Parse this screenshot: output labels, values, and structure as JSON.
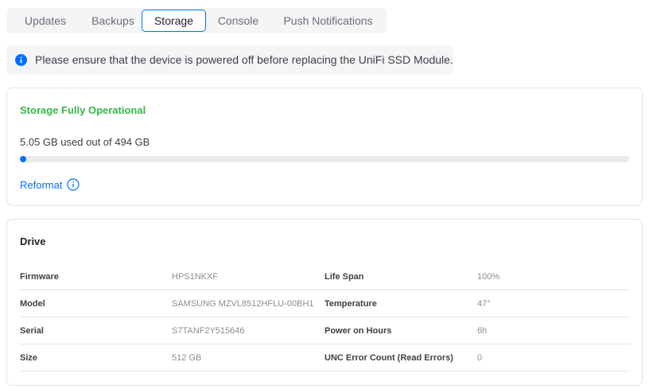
{
  "tabs": [
    {
      "label": "Updates",
      "active": false
    },
    {
      "label": "Backups",
      "active": false
    },
    {
      "label": "Storage",
      "active": true
    },
    {
      "label": "Console",
      "active": false
    },
    {
      "label": "Push Notifications",
      "active": false
    }
  ],
  "notice": {
    "icon": "info-icon",
    "text": "Please ensure that the device is powered off before replacing the UniFi SSD Module."
  },
  "storage": {
    "status": "Storage Fully Operational",
    "usage_text": "5.05 GB used out of 494 GB",
    "used_fraction": 0.0102,
    "reformat_label": "Reformat",
    "reformat_icon": "info-circle-icon"
  },
  "drive": {
    "title": "Drive",
    "left_rows": [
      {
        "label": "Firmware",
        "value": "HPS1NKXF"
      },
      {
        "label": "Model",
        "value": "SAMSUNG MZVL8512HFLU-00BH1"
      },
      {
        "label": "Serial",
        "value": "S7TANF2Y515646"
      },
      {
        "label": "Size",
        "value": "512 GB"
      }
    ],
    "right_rows": [
      {
        "label": "Life Span",
        "value": "100%"
      },
      {
        "label": "Temperature",
        "value": "47°"
      },
      {
        "label": "Power on Hours",
        "value": "6h"
      },
      {
        "label": "UNC Error Count (Read Errors)",
        "value": "0"
      }
    ]
  },
  "colors": {
    "accent": "#006fff",
    "success": "#39b54a"
  }
}
